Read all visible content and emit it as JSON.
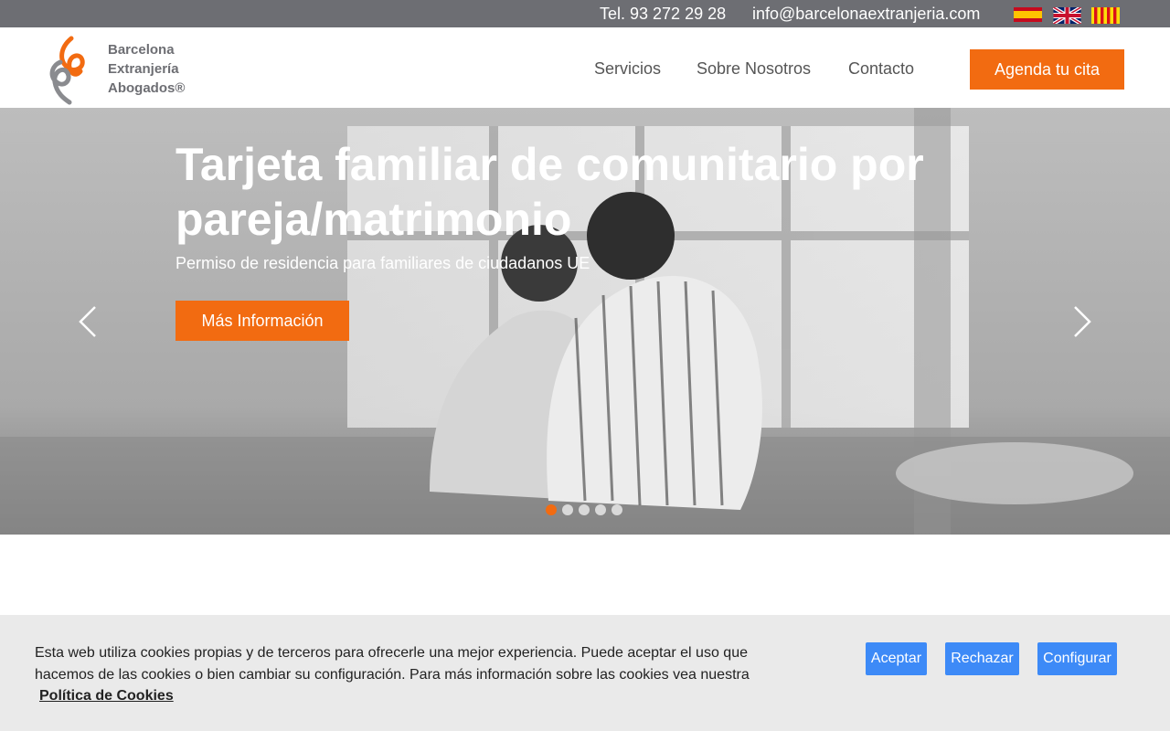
{
  "topbar": {
    "phone": "Tel. 93 272 29 28",
    "email": "info@barcelonaextranjeria.com",
    "flags": [
      "spanish-flag-icon",
      "uk-flag-icon",
      "catalan-flag-icon"
    ]
  },
  "header": {
    "logo_lines": [
      "Barcelona",
      "Extranjería",
      "Abogados®"
    ],
    "nav": [
      "Servicios",
      "Sobre Nosotros",
      "Contacto"
    ],
    "cta_label": "Agenda tu cita"
  },
  "hero": {
    "title": "Tarjeta familiar de comunitario por pareja/matrimonio",
    "subtitle": "Permiso de residencia para familiares de ciudadanos UE",
    "button_label": "Más Información",
    "slides_total": 5,
    "active_slide": 1
  },
  "cookie": {
    "text": "Esta web utiliza cookies propias y de terceros para ofrecerle una mejor experiencia. Puede aceptar el uso que hacemos de las cookies o bien cambiar su configuración. Para más información sobre las cookies vea nuestra",
    "link_label": "Política de Cookies",
    "accept_label": "Aceptar",
    "reject_label": "Rechazar",
    "configure_label": "Configurar"
  },
  "colors": {
    "accent": "#f26b11",
    "topbar": "#6d6e73",
    "cookie_button": "#3d8af7"
  }
}
